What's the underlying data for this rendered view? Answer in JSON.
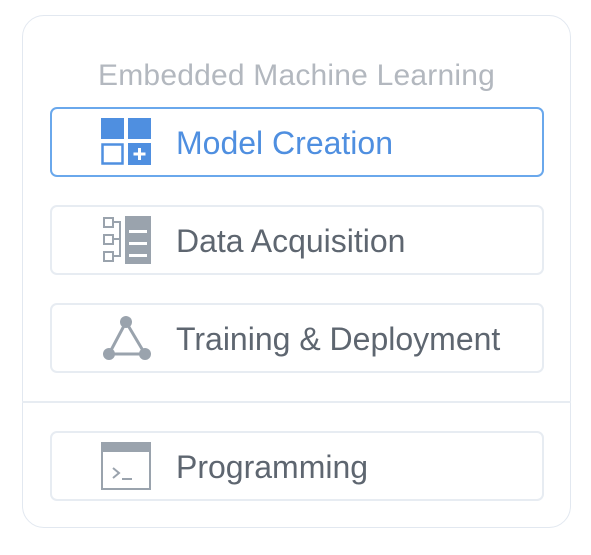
{
  "panel": {
    "title": "Embedded Machine Learning",
    "items": [
      {
        "label": "Model Creation",
        "icon": "model-creation-icon",
        "active": true
      },
      {
        "label": "Data Acquisition",
        "icon": "data-acquisition-icon",
        "active": false
      },
      {
        "label": "Training & Deployment",
        "icon": "training-deployment-icon",
        "active": false
      },
      {
        "label": "Programming",
        "icon": "terminal-icon",
        "active": false
      }
    ]
  },
  "colors": {
    "accent": "#4f8fe0",
    "active_border": "#6aa8ec",
    "icon_gray": "#9aa3ad",
    "text": "#5e6670",
    "title": "#b3b8bf"
  }
}
